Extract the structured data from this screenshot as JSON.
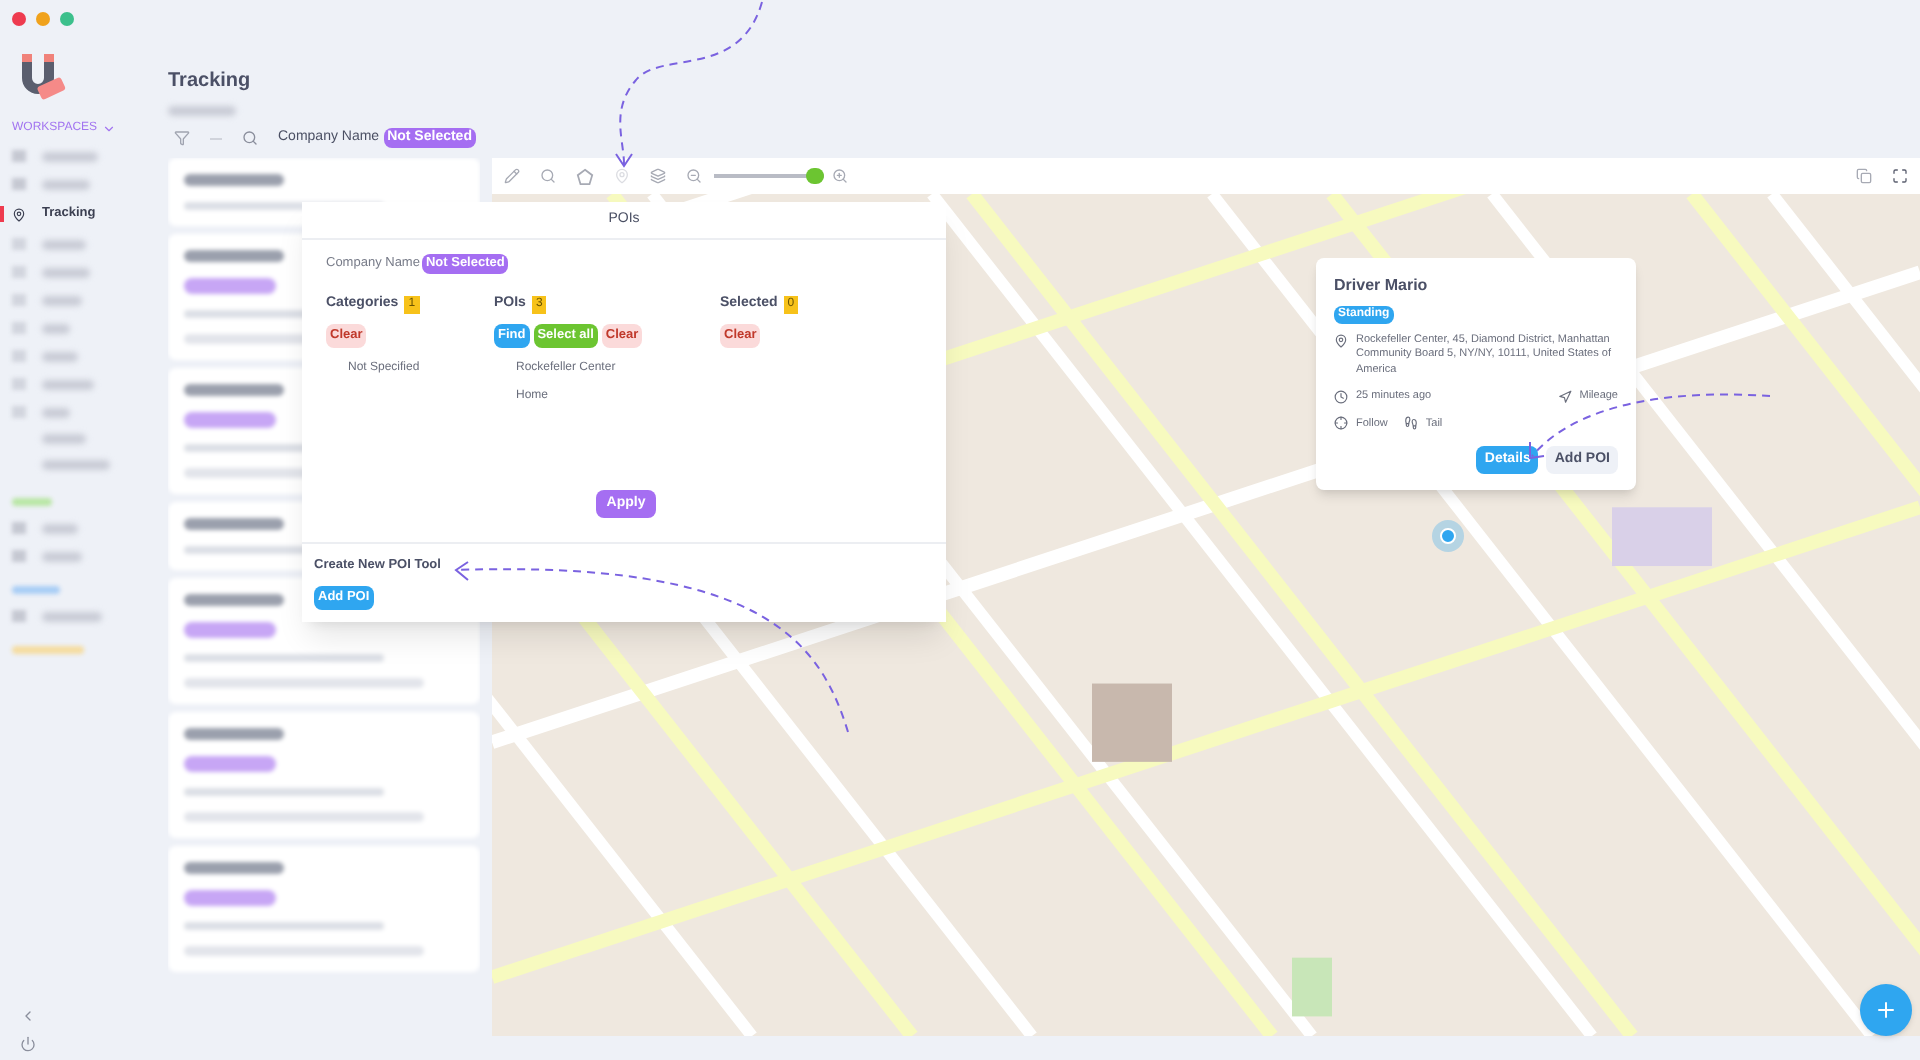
{
  "sidebar": {
    "section": "WORKSPACES",
    "items": [
      {
        "label": "Tracking",
        "selected": true
      }
    ]
  },
  "page": {
    "title": "Tracking"
  },
  "filter": {
    "label": "Company Name",
    "value": "Not Selected"
  },
  "map_toolbar": {
    "zoom_slider": {
      "level": 0.92
    }
  },
  "poi_panel": {
    "title": "POIs",
    "company_label": "Company Name",
    "company_value": "Not Selected",
    "columns": [
      {
        "title": "Categories",
        "count": "1",
        "buttons": [
          {
            "label": "Clear",
            "kind": "clear",
            "disabled": true
          }
        ],
        "items": [
          "Not Specified"
        ]
      },
      {
        "title": "POIs",
        "count": "3",
        "buttons": [
          {
            "label": "Find",
            "kind": "find",
            "disabled": false
          },
          {
            "label": "Select all",
            "kind": "select",
            "disabled": false
          },
          {
            "label": "Clear",
            "kind": "clear",
            "disabled": true
          }
        ],
        "items": [
          "Rockefeller Center",
          "Home"
        ]
      },
      {
        "title": "Selected",
        "count": "0",
        "buttons": [
          {
            "label": "Clear",
            "kind": "clear",
            "disabled": true
          }
        ]
      }
    ],
    "apply": "Apply",
    "create_title": "Create New POI Tool",
    "add_button": "Add POI"
  },
  "driver_card": {
    "name": "Driver Mario",
    "status": "Standing",
    "address": "Rockefeller Center, 45, Diamond District, Manhattan Community Board 5, NY/NY, 10111, United States of America",
    "time": "25 minutes ago",
    "mileage": "Mileage",
    "follow": "Follow",
    "tail": "Tail",
    "buttons": [
      {
        "label": "Details",
        "kind": "primary"
      },
      {
        "label": "Add POI",
        "kind": "secondary"
      }
    ]
  }
}
